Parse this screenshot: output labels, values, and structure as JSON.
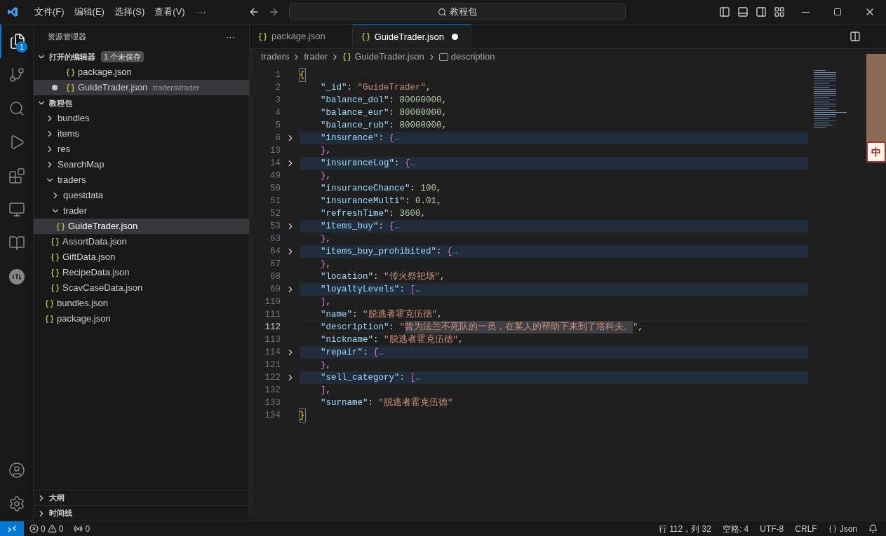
{
  "title_bar": {
    "menus": [
      "文件(F)",
      "编辑(E)",
      "选择(S)",
      "查看(V)"
    ],
    "more": "···",
    "search": "教程包"
  },
  "activity_bar": {
    "explorer_badge": "1"
  },
  "sidebar": {
    "title": "资源管理器",
    "more": "···",
    "open_editors": {
      "title": "打开的编辑器",
      "expanded": true,
      "badge": "1 个未保存",
      "items": [
        {
          "name": "package.json",
          "modified": false,
          "selected": false
        },
        {
          "name": "GuideTrader.json",
          "path": "traders\\trader",
          "modified": true,
          "selected": true
        }
      ]
    },
    "folder": {
      "title": "教程包",
      "expanded": true,
      "children": [
        {
          "kind": "folder",
          "name": "bundles",
          "expanded": false,
          "selected": false
        },
        {
          "kind": "folder",
          "name": "items",
          "expanded": false,
          "selected": false
        },
        {
          "kind": "folder",
          "name": "res",
          "expanded": false,
          "selected": false
        },
        {
          "kind": "folder",
          "name": "SearchMap",
          "expanded": false,
          "selected": false
        },
        {
          "kind": "folder",
          "name": "traders",
          "expanded": true,
          "selected": false,
          "children": [
            {
              "kind": "folder",
              "name": "questdata",
              "expanded": false,
              "selected": false
            },
            {
              "kind": "folder",
              "name": "trader",
              "expanded": true,
              "selected": false,
              "children": [
                {
                  "kind": "file",
                  "name": "GuideTrader.json",
                  "selected": true
                }
              ]
            },
            {
              "kind": "file",
              "name": "AssortData.json",
              "selected": false
            },
            {
              "kind": "file",
              "name": "GiftData.json",
              "selected": false
            },
            {
              "kind": "file",
              "name": "RecipeData.json",
              "selected": false
            },
            {
              "kind": "file",
              "name": "ScavCaseData.json",
              "selected": false
            }
          ]
        },
        {
          "kind": "file",
          "name": "bundles.json",
          "selected": false
        },
        {
          "kind": "file",
          "name": "package.json",
          "selected": false
        }
      ]
    },
    "panels": [
      {
        "title": "大纲",
        "expanded": false
      },
      {
        "title": "时间线",
        "expanded": false
      }
    ]
  },
  "tabs": [
    {
      "label": "package.json",
      "selected": false,
      "modified": false
    },
    {
      "label": "GuideTrader.json",
      "selected": true,
      "modified": true
    }
  ],
  "breadcrumbs": [
    "traders",
    "trader",
    "GuideTrader.json",
    "description"
  ],
  "code_lines": [
    {
      "number": "1",
      "indented": false,
      "folded": false,
      "current": false,
      "tokens": [
        {
          "kind": "brace1",
          "text": "{"
        }
      ]
    },
    {
      "number": "2",
      "indented": true,
      "folded": false,
      "current": false,
      "tokens": [
        {
          "kind": "key",
          "text": "\"_id\""
        },
        {
          "kind": "punct",
          "text": ": "
        },
        {
          "kind": "string",
          "text": "\"GuideTrader\""
        },
        {
          "kind": "punct",
          "text": ","
        }
      ]
    },
    {
      "number": "3",
      "indented": true,
      "folded": false,
      "current": false,
      "tokens": [
        {
          "kind": "key",
          "text": "\"balance_dol\""
        },
        {
          "kind": "punct",
          "text": ": "
        },
        {
          "kind": "number",
          "text": "80000000"
        },
        {
          "kind": "punct",
          "text": ","
        }
      ]
    },
    {
      "number": "4",
      "indented": true,
      "folded": false,
      "current": false,
      "tokens": [
        {
          "kind": "key",
          "text": "\"balance_eur\""
        },
        {
          "kind": "punct",
          "text": ": "
        },
        {
          "kind": "number",
          "text": "80000000"
        },
        {
          "kind": "punct",
          "text": ","
        }
      ]
    },
    {
      "number": "5",
      "indented": true,
      "folded": false,
      "current": false,
      "tokens": [
        {
          "kind": "key",
          "text": "\"balance_rub\""
        },
        {
          "kind": "punct",
          "text": ": "
        },
        {
          "kind": "number",
          "text": "80000000"
        },
        {
          "kind": "punct",
          "text": ","
        }
      ]
    },
    {
      "number": "6",
      "indented": true,
      "folded": true,
      "current": false,
      "tokens": [
        {
          "kind": "key",
          "text": "\"insurance\""
        },
        {
          "kind": "punct",
          "text": ": "
        },
        {
          "kind": "brace2",
          "text": "{"
        },
        {
          "kind": "ellipsis",
          "text": "…"
        }
      ]
    },
    {
      "number": "13",
      "indented": true,
      "folded": false,
      "current": false,
      "tokens": [
        {
          "kind": "brace2",
          "text": "}"
        },
        {
          "kind": "punct",
          "text": ","
        }
      ]
    },
    {
      "number": "14",
      "indented": true,
      "folded": true,
      "current": false,
      "tokens": [
        {
          "kind": "key",
          "text": "\"insuranceLog\""
        },
        {
          "kind": "punct",
          "text": ": "
        },
        {
          "kind": "brace2",
          "text": "{"
        },
        {
          "kind": "ellipsis",
          "text": "…"
        }
      ]
    },
    {
      "number": "49",
      "indented": true,
      "folded": false,
      "current": false,
      "tokens": [
        {
          "kind": "brace2",
          "text": "}"
        },
        {
          "kind": "punct",
          "text": ","
        }
      ]
    },
    {
      "number": "50",
      "indented": true,
      "folded": false,
      "current": false,
      "tokens": [
        {
          "kind": "key",
          "text": "\"insuranceChance\""
        },
        {
          "kind": "punct",
          "text": ": "
        },
        {
          "kind": "number",
          "text": "100"
        },
        {
          "kind": "punct",
          "text": ","
        }
      ]
    },
    {
      "number": "51",
      "indented": true,
      "folded": false,
      "current": false,
      "tokens": [
        {
          "kind": "key",
          "text": "\"insuranceMulti\""
        },
        {
          "kind": "punct",
          "text": ": "
        },
        {
          "kind": "number",
          "text": "0.01"
        },
        {
          "kind": "punct",
          "text": ","
        }
      ]
    },
    {
      "number": "52",
      "indented": true,
      "folded": false,
      "current": false,
      "tokens": [
        {
          "kind": "key",
          "text": "\"refreshTime\""
        },
        {
          "kind": "punct",
          "text": ": "
        },
        {
          "kind": "number",
          "text": "3600"
        },
        {
          "kind": "punct",
          "text": ","
        }
      ]
    },
    {
      "number": "53",
      "indented": true,
      "folded": true,
      "current": false,
      "tokens": [
        {
          "kind": "key",
          "text": "\"items_buy\""
        },
        {
          "kind": "punct",
          "text": ": "
        },
        {
          "kind": "brace2",
          "text": "{"
        },
        {
          "kind": "ellipsis",
          "text": "…"
        }
      ]
    },
    {
      "number": "63",
      "indented": true,
      "folded": false,
      "current": false,
      "tokens": [
        {
          "kind": "brace2",
          "text": "}"
        },
        {
          "kind": "punct",
          "text": ","
        }
      ]
    },
    {
      "number": "64",
      "indented": true,
      "folded": true,
      "current": false,
      "tokens": [
        {
          "kind": "key",
          "text": "\"items_buy_prohibited\""
        },
        {
          "kind": "punct",
          "text": ": "
        },
        {
          "kind": "brace2",
          "text": "{"
        },
        {
          "kind": "ellipsis",
          "text": "…"
        }
      ]
    },
    {
      "number": "67",
      "indented": true,
      "folded": false,
      "current": false,
      "tokens": [
        {
          "kind": "brace2",
          "text": "}"
        },
        {
          "kind": "punct",
          "text": ","
        }
      ]
    },
    {
      "number": "68",
      "indented": true,
      "folded": false,
      "current": false,
      "tokens": [
        {
          "kind": "key",
          "text": "\"location\""
        },
        {
          "kind": "punct",
          "text": ": "
        },
        {
          "kind": "string",
          "text": "\"传火祭祀场\""
        },
        {
          "kind": "punct",
          "text": ","
        }
      ]
    },
    {
      "number": "69",
      "indented": true,
      "folded": true,
      "current": false,
      "tokens": [
        {
          "kind": "key",
          "text": "\"loyaltyLevels\""
        },
        {
          "kind": "punct",
          "text": ": "
        },
        {
          "kind": "brace2",
          "text": "["
        },
        {
          "kind": "ellipsis",
          "text": "…"
        }
      ]
    },
    {
      "number": "110",
      "indented": true,
      "folded": false,
      "current": false,
      "tokens": [
        {
          "kind": "brace2",
          "text": "]"
        },
        {
          "kind": "punct",
          "text": ","
        }
      ]
    },
    {
      "number": "111",
      "indented": true,
      "folded": false,
      "current": false,
      "tokens": [
        {
          "kind": "key",
          "text": "\"name\""
        },
        {
          "kind": "punct",
          "text": ": "
        },
        {
          "kind": "string",
          "text": "\"脱逃者霍克伍德\""
        },
        {
          "kind": "punct",
          "text": ","
        }
      ]
    },
    {
      "number": "112",
      "indented": true,
      "folded": false,
      "current": true,
      "tokens": [
        {
          "kind": "key",
          "text": "\"description\""
        },
        {
          "kind": "punct",
          "text": ": "
        },
        {
          "kind": "string",
          "text": "\""
        },
        {
          "kind": "selected",
          "text": "曾为法兰不死队的一员，"
        },
        {
          "kind": "selected",
          "text": "在某人的帮助下来到了塔科夫。"
        },
        {
          "kind": "string",
          "text": "\""
        },
        {
          "kind": "punct",
          "text": ","
        }
      ]
    },
    {
      "number": "113",
      "indented": true,
      "folded": false,
      "current": false,
      "tokens": [
        {
          "kind": "key",
          "text": "\"nickname\""
        },
        {
          "kind": "punct",
          "text": ": "
        },
        {
          "kind": "string",
          "text": "\"脱逃者霍克伍德\""
        },
        {
          "kind": "punct",
          "text": ","
        }
      ]
    },
    {
      "number": "114",
      "indented": true,
      "folded": true,
      "current": false,
      "tokens": [
        {
          "kind": "key",
          "text": "\"repair\""
        },
        {
          "kind": "punct",
          "text": ": "
        },
        {
          "kind": "brace2",
          "text": "{"
        },
        {
          "kind": "ellipsis",
          "text": "…"
        }
      ]
    },
    {
      "number": "121",
      "indented": true,
      "folded": false,
      "current": false,
      "tokens": [
        {
          "kind": "brace2",
          "text": "}"
        },
        {
          "kind": "punct",
          "text": ","
        }
      ]
    },
    {
      "number": "122",
      "indented": true,
      "folded": true,
      "current": false,
      "tokens": [
        {
          "kind": "key",
          "text": "\"sell_category\""
        },
        {
          "kind": "punct",
          "text": ": "
        },
        {
          "kind": "brace2",
          "text": "["
        },
        {
          "kind": "ellipsis",
          "text": "…"
        }
      ]
    },
    {
      "number": "132",
      "indented": true,
      "folded": false,
      "current": false,
      "tokens": [
        {
          "kind": "brace2",
          "text": "]"
        },
        {
          "kind": "punct",
          "text": ","
        }
      ]
    },
    {
      "number": "133",
      "indented": true,
      "folded": false,
      "current": false,
      "tokens": [
        {
          "kind": "key",
          "text": "\"surname\""
        },
        {
          "kind": "punct",
          "text": ": "
        },
        {
          "kind": "string",
          "text": "\"脱逃者霍克伍德\""
        }
      ]
    },
    {
      "number": "134",
      "indented": false,
      "folded": false,
      "current": false,
      "tokens": [
        {
          "kind": "brace1",
          "text": "}"
        }
      ]
    }
  ],
  "overlay": {
    "ime_badge": "中"
  },
  "status_bar": {
    "errors": "0",
    "warnings": "0",
    "ports": "0",
    "position": "行 112，列 32",
    "indent": "空格: 4",
    "encoding": "UTF-8",
    "eol": "CRLF",
    "language": "Json"
  }
}
